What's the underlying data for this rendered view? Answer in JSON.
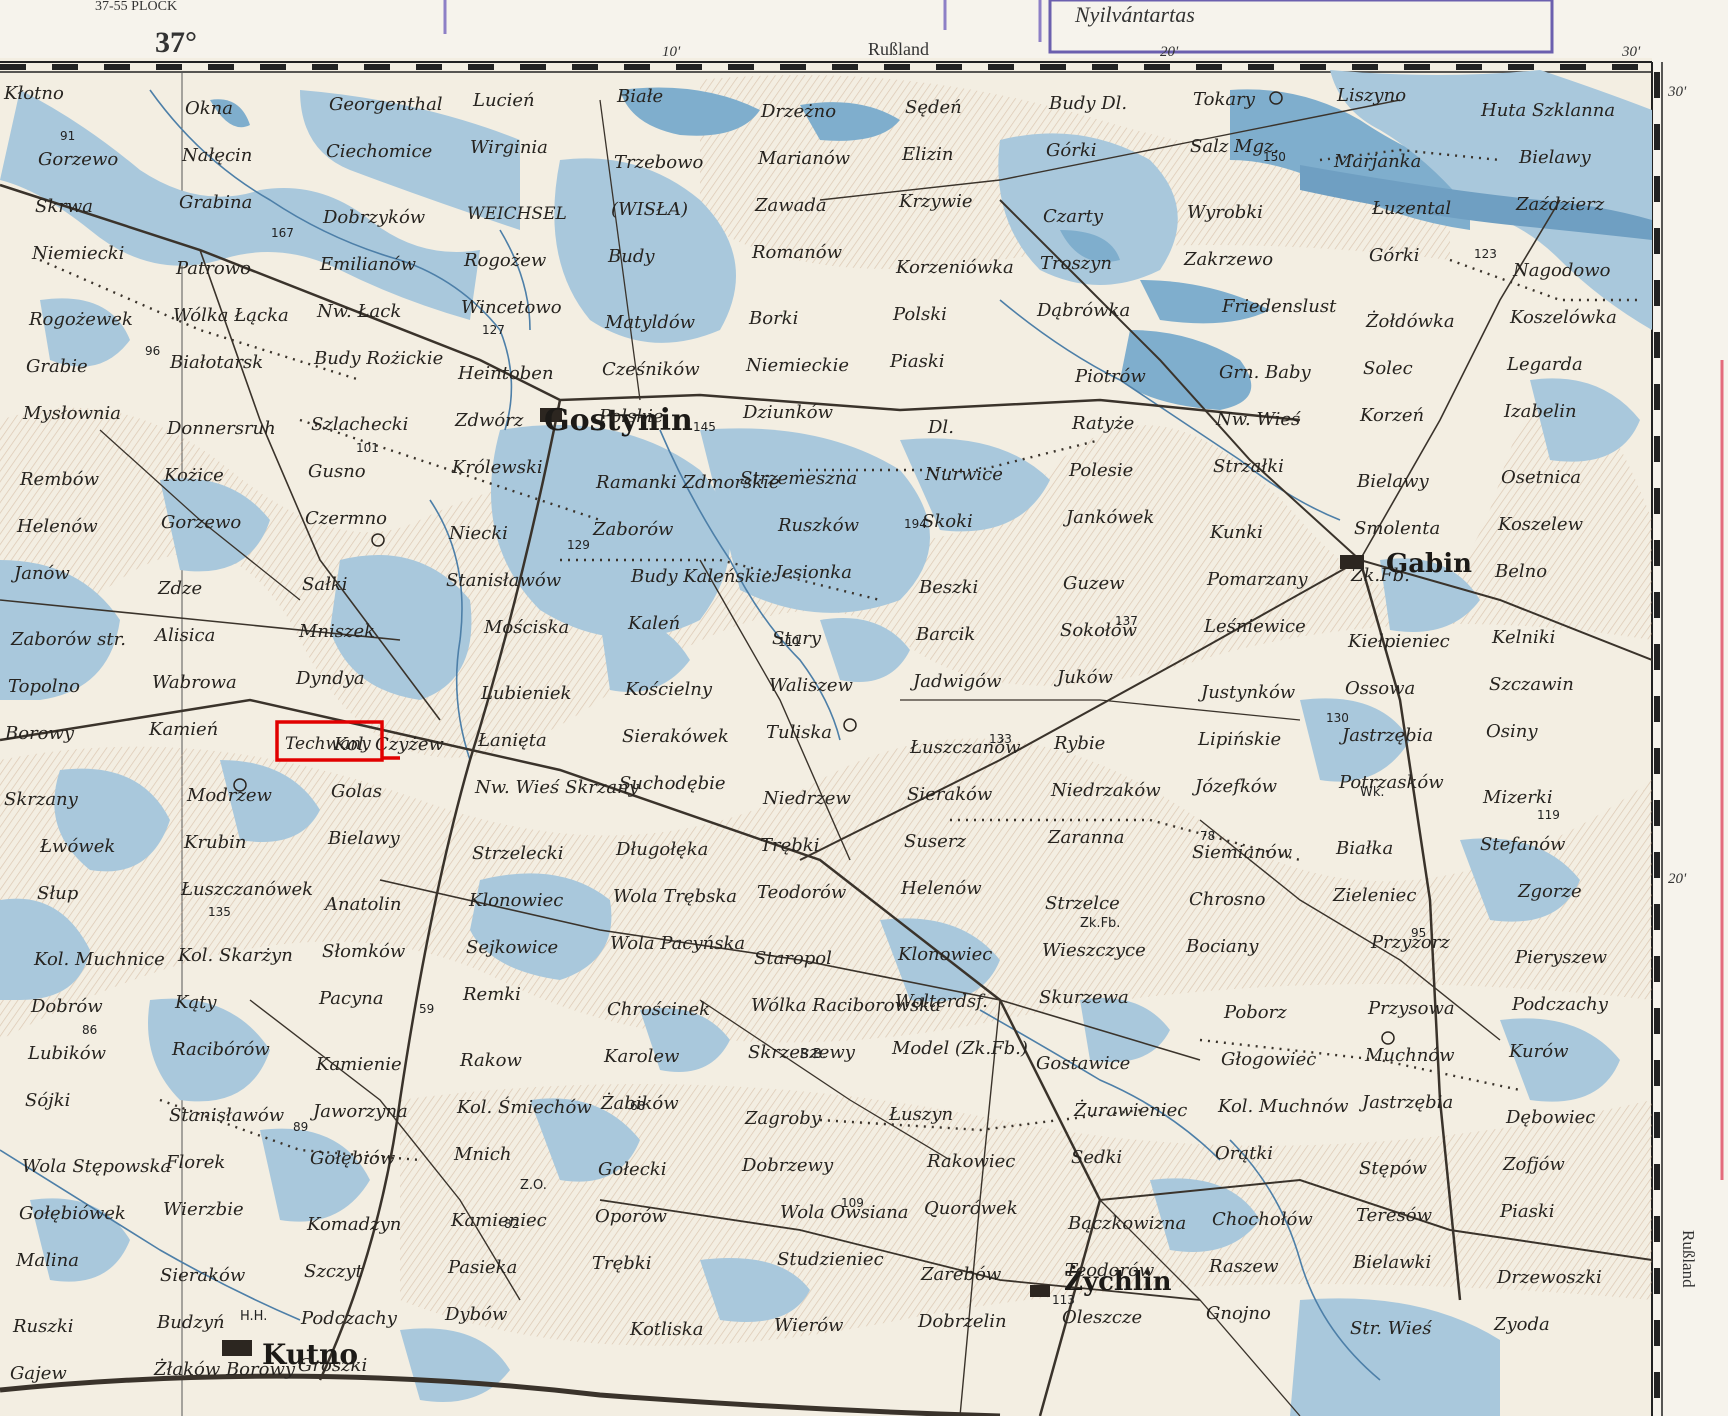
{
  "sheet": {
    "header_left": "37-55 PLOCK",
    "stamp_text": "Nyilvántartas",
    "top_border_label": "Rußland",
    "right_border_label": "Rußland",
    "meridian_label": "37°",
    "top_ticks": [
      "10'",
      "20'",
      "30'"
    ],
    "right_ticks": [
      "30'",
      "20'"
    ]
  },
  "colors": {
    "paper": "#f4efe3",
    "water": "#a9c8dc",
    "water_dark": "#7faecd",
    "relief": "#c9a98d",
    "road": "#3a332b",
    "highlight": "#e10000"
  },
  "highlight": {
    "label": "Techwany"
  },
  "towns": [
    {
      "label": "Gostynin"
    },
    {
      "label": "Gabin"
    },
    {
      "label": "Kutno"
    },
    {
      "label": "Żychlin"
    }
  ],
  "places": [
    "Kłotno",
    "Okna",
    "Georgenthal",
    "Lucień",
    "Białe",
    "Drzeżno",
    "Sędeń",
    "Budy Dl.",
    "Tokary",
    "Liszyno",
    "Huta Szklanna",
    "Gorzewo",
    "Nałęcin",
    "Ciechomice",
    "Wirginia",
    "Trzebowo",
    "Marianów",
    "Elizin",
    "Górki",
    "Salz Mgz.",
    "Marjanka",
    "Bielawy",
    "Skrwa",
    "Grabina",
    "Dobrzyków",
    "WEICHSEL",
    "(WISŁA)",
    "Zawada",
    "Krzywie",
    "Czarty",
    "Wyrobki",
    "Łuzental",
    "Zaździerz",
    "Niemiecki",
    "Patrowo",
    "Emilianów",
    "Rogożew",
    "Budy",
    "Romanów",
    "Korzeniówka",
    "Troszyn",
    "Zakrzewo",
    "Górki",
    "Nagodowo",
    "Rogożewek",
    "Wólka Łącka",
    "Nw. Łack",
    "Wincetowo",
    "Matyldów",
    "Borki",
    "Polski",
    "Dąbrówka",
    "Friedenslust",
    "Żołdówka",
    "Koszelówka",
    "Grabie",
    "Białotarsk",
    "Budy Rożickie",
    "Heintoben",
    "Cześników",
    "Niemieckie",
    "Piaski",
    "Piotrów",
    "Grn. Baby",
    "Solec",
    "Legarda",
    "Mysłownia",
    "Donnersruh",
    "Szlachecki",
    "Zdwórz",
    "Polskie",
    "Dziunków",
    "Dl.",
    "Ratyże",
    "Nw. Wieś",
    "Korzeń",
    "Izabelin",
    "Rembów",
    "Kożice",
    "Gusno",
    "Królewski",
    "Ramanki Zdmorskie",
    "Strzemeszna",
    "Nurwice",
    "Polesie",
    "Strzałki",
    "Bielawy",
    "Osetnica",
    "Helenów",
    "Gorzewo",
    "Czermno",
    "Niecki",
    "Zaborów",
    "Ruszków",
    "Skoki",
    "Jankówek",
    "Kunki",
    "Smolenta",
    "Koszelew",
    "Janów",
    "Zdze",
    "Sałki",
    "Stanisławów",
    "Budy Kaleńskie",
    "Jesionka",
    "Beszki",
    "Guzew",
    "Pomarzany",
    "Zk.Fb.",
    "Belno",
    "Zaborów str.",
    "Alisica",
    "Mniszek",
    "Mościska",
    "Kaleń",
    "Stary",
    "Barcik",
    "Sokołów",
    "Leśniewice",
    "Kiełpieniec",
    "Kelniki",
    "Topolno",
    "Wabrowa",
    "Dyndya",
    "Lubieniek",
    "Kościelny",
    "Waliszew",
    "Jadwigów",
    "Juków",
    "Justynków",
    "Ossowa",
    "Szczawin",
    "Borowy",
    "Kamień",
    "Kol. Czyżew",
    "Łanięta",
    "Sierakówek",
    "Tuliska",
    "Łuszczanów",
    "Rybie",
    "Lipińskie",
    "Jastrzębia",
    "Osiny",
    "Skrzany",
    "Modrzew",
    "Golas",
    "Nw. Wieś Skrzany",
    "Suchodębie",
    "Niedrzew",
    "Sieraków",
    "Niedrzaków",
    "Józefków",
    "Potrzasków",
    "Mizerki",
    "Łwówek",
    "Krubin",
    "Bielawy",
    "Strzelecki",
    "Długołęka",
    "Trębki",
    "Suserz",
    "Zaranna",
    "Siemianów",
    "Białka",
    "Stefanów",
    "Słup",
    "Łuszczanówek",
    "Anatolin",
    "Klonowiec",
    "Wola Trębska",
    "Teodorów",
    "Helenów",
    "Strzelce",
    "Chrosno",
    "Zieleniec",
    "Zgorze",
    "Kol. Muchnice",
    "Kol. Skarżyn",
    "Słomków",
    "Sejkowice",
    "Wola Pacyńska",
    "Staropol",
    "Klonowiec",
    "Wieszczyce",
    "Bociany",
    "Przyzorz",
    "Pieryszew",
    "Dobrów",
    "Kąty",
    "Pacyna",
    "Remki",
    "Chrościnek",
    "Wólka Raciborowska",
    "Wolterdsf.",
    "Skurzewa",
    "Poborz",
    "Przysowa",
    "Podczachy",
    "Lubików",
    "Racibórów",
    "Kamienie",
    "Rakow",
    "Karolew",
    "Skrzeszewy",
    "Model (Zk.Fb.)",
    "Gostawice",
    "Głogowiec",
    "Muchnów",
    "Kurów",
    "Sójki",
    "Stanisławów",
    "Jaworzyna",
    "Kol. Śmiechów",
    "Żabików",
    "Zagroby",
    "Łuszyn",
    "Żurawieniec",
    "Kol. Muchnów",
    "Jastrzębia",
    "Dębowiec",
    "Wola Stępowska",
    "Florek",
    "Gołębiów",
    "Mnich",
    "Gołecki",
    "Dobrzewy",
    "Rakowiec",
    "Sedki",
    "Orątki",
    "Stępów",
    "Zofjów",
    "Gołębiówek",
    "Wierzbie",
    "Komadzyn",
    "Kamieniec",
    "Oporów",
    "Wola Owsiana",
    "Quorówek",
    "Bączkowizna",
    "Chochołów",
    "Teresów",
    "Piaski",
    "Malina",
    "Sieraków",
    "Szczyt",
    "Pasieka",
    "Trębki",
    "Studzieniec",
    "Zarebów",
    "Teodorów",
    "Raszew",
    "Bielawki",
    "Drzewoszki",
    "Ruszki",
    "Budzyń",
    "Podczachy",
    "Dybów",
    "Kotliska",
    "Wierów",
    "Dobrzelin",
    "Oleszcze",
    "Gnojno",
    "Str. Wieś",
    "Zyoda",
    "Gajew",
    "Żłaków Borowy",
    "Groszki"
  ],
  "spot_heights": [
    "91",
    "167",
    "127",
    "145",
    "194",
    "137",
    "130",
    "119",
    "135",
    "59",
    "68",
    "109",
    "113",
    "150",
    "123",
    "96",
    "101",
    "129",
    "111",
    "133",
    "78",
    "95",
    "86",
    "89",
    "82"
  ],
  "abbrev_marks": [
    "H.H.",
    "Z.O.",
    "B.B.",
    "Zk.Fb.",
    "Wk."
  ]
}
